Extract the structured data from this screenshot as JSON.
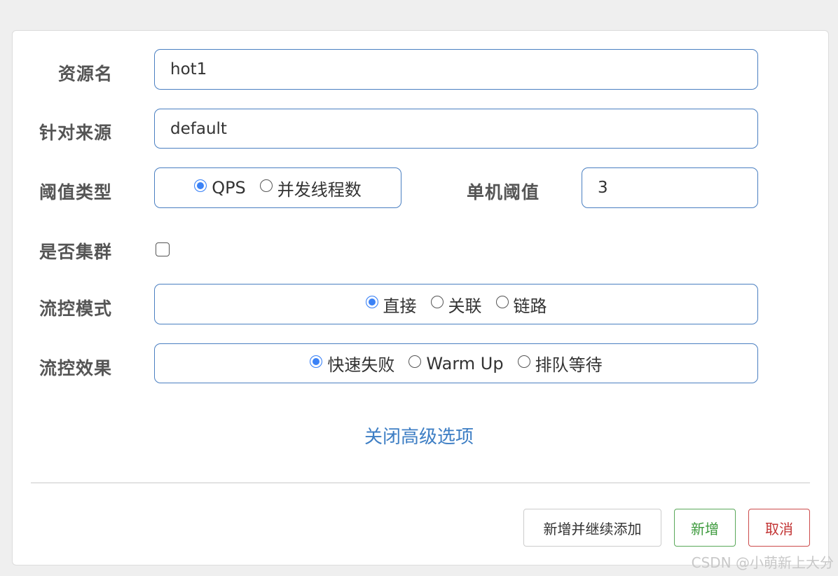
{
  "form": {
    "resource_name": {
      "label": "资源名",
      "value": "hot1"
    },
    "limit_app": {
      "label": "针对来源",
      "value": "default"
    },
    "threshold_type": {
      "label": "阈值类型",
      "options": [
        "QPS",
        "并发线程数"
      ],
      "selected": "QPS"
    },
    "single_threshold": {
      "label": "单机阈值",
      "value": "3"
    },
    "cluster": {
      "label": "是否集群",
      "checked": false
    },
    "flow_mode": {
      "label": "流控模式",
      "options": [
        "直接",
        "关联",
        "链路"
      ],
      "selected": "直接"
    },
    "flow_effect": {
      "label": "流控效果",
      "options": [
        "快速失败",
        "Warm Up",
        "排队等待"
      ],
      "selected": "快速失败"
    },
    "advanced_toggle": "关闭高级选项"
  },
  "footer": {
    "add_continue": "新增并继续添加",
    "add": "新增",
    "cancel": "取消"
  },
  "watermark": "CSDN @小萌新上大分",
  "colors": {
    "accent": "#3b82f6",
    "link": "#3d7ec4",
    "success": "#3d9a3d",
    "danger": "#c23333"
  }
}
